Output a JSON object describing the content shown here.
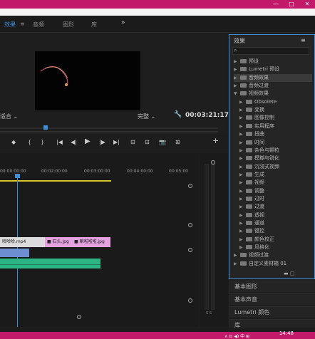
{
  "window": {
    "minimize": "—",
    "maximize": "□",
    "close": "✕"
  },
  "tabs": {
    "effects": "效果",
    "sep": "≡",
    "audio": "音频",
    "graphics": "图形",
    "library": "库",
    "more": "»"
  },
  "program": {
    "fit": "适合",
    "resolution": "完整",
    "timecode": "00:03:21:17"
  },
  "transport": [
    "◆",
    "{",
    "}",
    "|◀",
    "◀|",
    "▶",
    "|▶",
    "▶|",
    "⊟",
    "⊟",
    "📷",
    "⊞",
    "+"
  ],
  "timeline": {
    "times": [
      "00:00:00:00",
      "00:02:00:00",
      "00:03:00:00",
      "00:04:00:00",
      "00:05:00"
    ],
    "clips": [
      {
        "label": "哈哈哈.mp4"
      },
      {
        "label": "■ 石头.jpg"
      },
      {
        "label": "■ 嘛啦啦啦.jpg"
      }
    ],
    "meter_label": "S  S"
  },
  "effects_panel": {
    "title": "效果",
    "menu": "≡",
    "search_icon": "⌕",
    "items": [
      {
        "label": "预设",
        "indent": 1,
        "open": false
      },
      {
        "label": "Lumetri 预设",
        "indent": 1,
        "open": false
      },
      {
        "label": "音频效果",
        "indent": 1,
        "open": false,
        "selected": true
      },
      {
        "label": "音频过渡",
        "indent": 1,
        "open": false
      },
      {
        "label": "视频效果",
        "indent": 1,
        "open": true
      },
      {
        "label": "Obsolete",
        "indent": 2,
        "open": false
      },
      {
        "label": "变换",
        "indent": 2,
        "open": false
      },
      {
        "label": "图像控制",
        "indent": 2,
        "open": false
      },
      {
        "label": "实用程序",
        "indent": 2,
        "open": false
      },
      {
        "label": "扭曲",
        "indent": 2,
        "open": false
      },
      {
        "label": "时间",
        "indent": 2,
        "open": false
      },
      {
        "label": "杂色与颗粒",
        "indent": 2,
        "open": false
      },
      {
        "label": "模糊与锐化",
        "indent": 2,
        "open": false
      },
      {
        "label": "沉浸式视频",
        "indent": 2,
        "open": false
      },
      {
        "label": "生成",
        "indent": 2,
        "open": false
      },
      {
        "label": "视频",
        "indent": 2,
        "open": false
      },
      {
        "label": "调整",
        "indent": 2,
        "open": false
      },
      {
        "label": "过时",
        "indent": 2,
        "open": false
      },
      {
        "label": "过渡",
        "indent": 2,
        "open": false
      },
      {
        "label": "透视",
        "indent": 2,
        "open": false
      },
      {
        "label": "通道",
        "indent": 2,
        "open": false
      },
      {
        "label": "键控",
        "indent": 2,
        "open": false
      },
      {
        "label": "颜色校正",
        "indent": 2,
        "open": false
      },
      {
        "label": "风格化",
        "indent": 2,
        "open": false
      },
      {
        "label": "视频过渡",
        "indent": 1,
        "open": false
      },
      {
        "label": "自定义素材箱 01",
        "indent": 1,
        "open": false
      }
    ]
  },
  "side_panels": [
    "基本图形",
    "基本声音",
    "Lumetri 颜色",
    "库"
  ],
  "taskbar": {
    "clock": "14:48",
    "tray": "∧  ⊡  ◀)  中  ⊞"
  },
  "colors": {
    "accent": "#3d8fd9",
    "titlebar": "#c2196b",
    "clip_pink": "#e3a1e0",
    "audio_green": "#2bb484"
  }
}
